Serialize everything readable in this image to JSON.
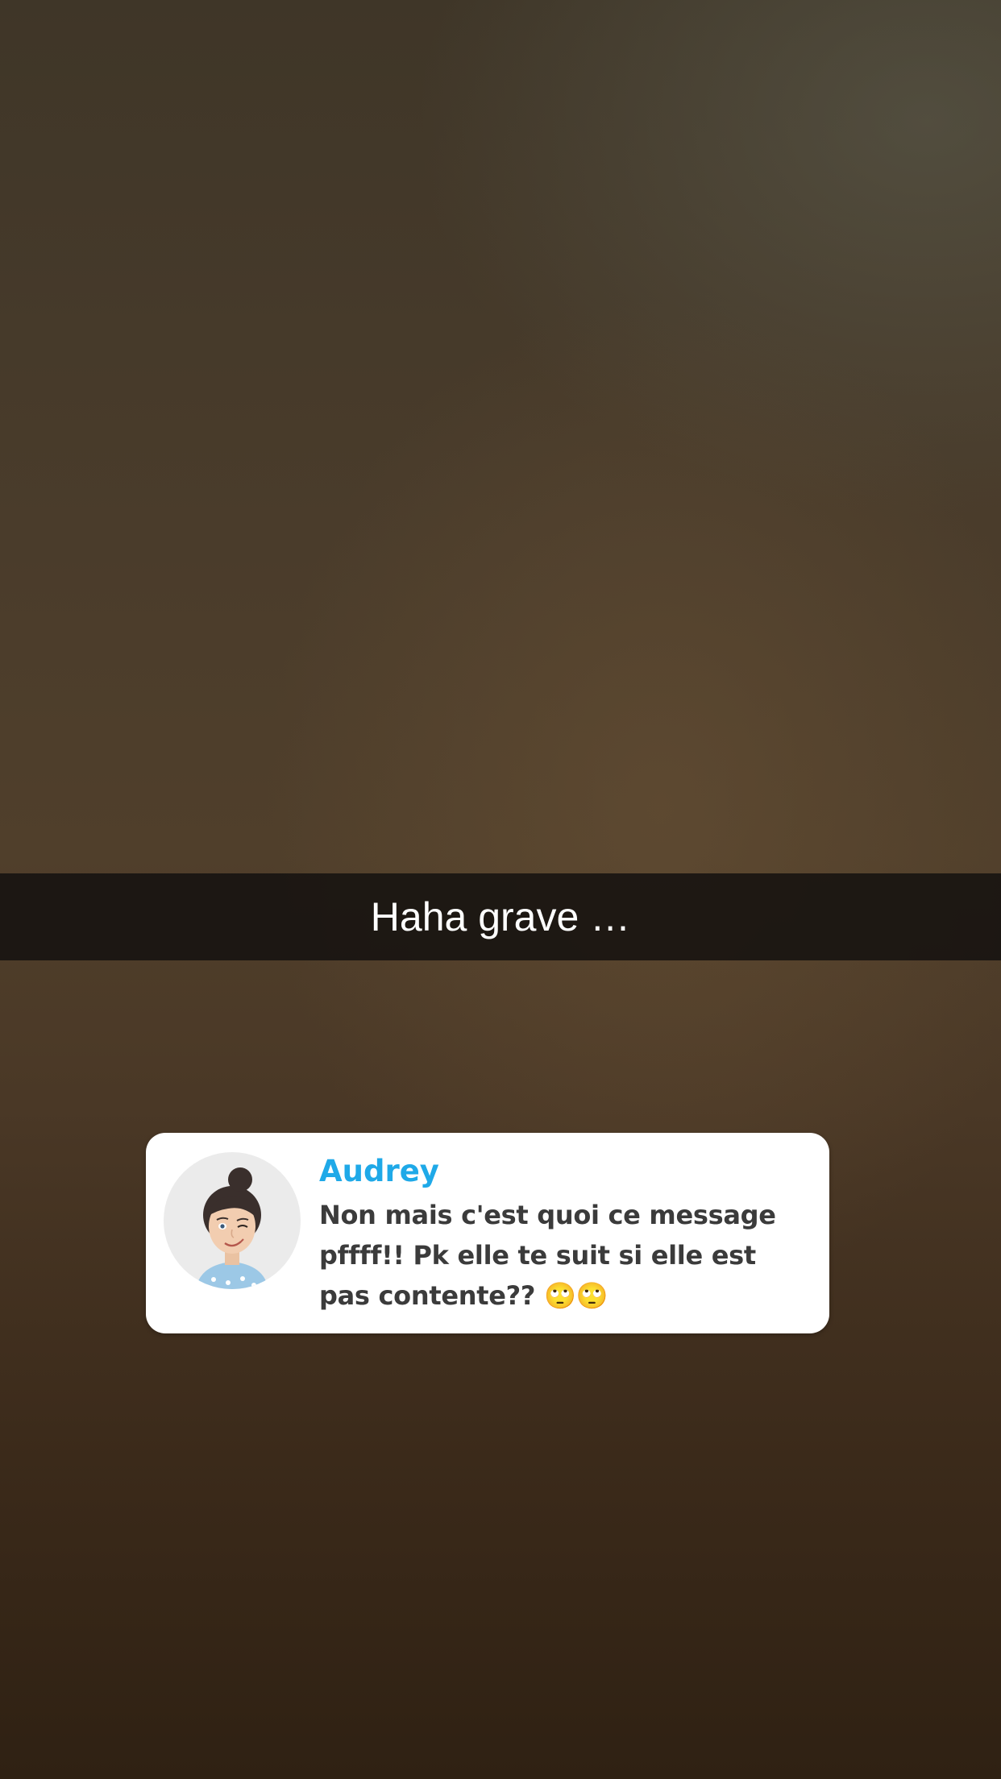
{
  "snap": {
    "caption": "Haha grave …"
  },
  "chat": {
    "sender_name": "Audrey",
    "sender_color": "#1fa9e8",
    "avatar_icon": "bitmoji-avatar-icon",
    "message": "Non mais c'est quoi ce message pffff!! Pk elle te suit si elle est pas contente?? 🙄🙄"
  }
}
